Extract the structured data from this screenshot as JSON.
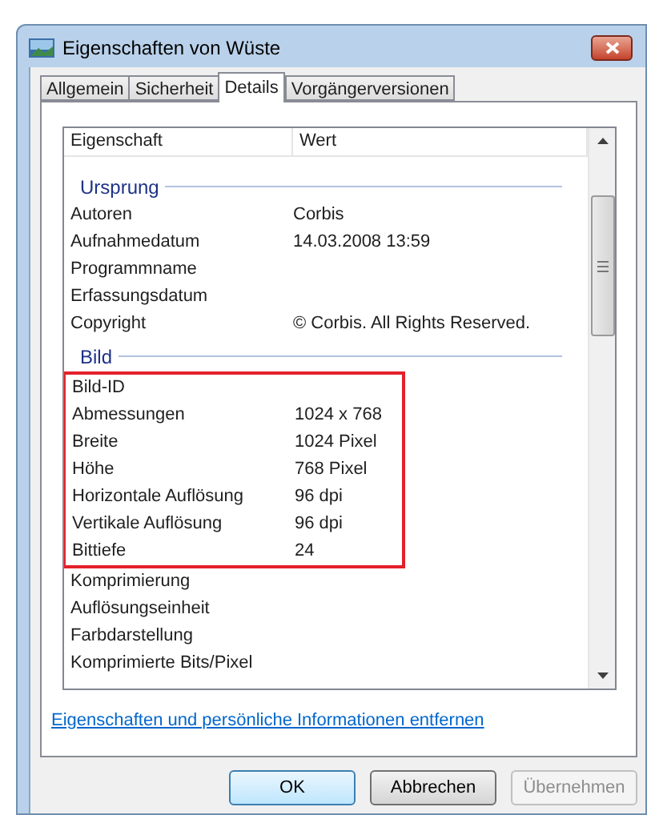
{
  "window": {
    "title": "Eigenschaften von Wüste"
  },
  "tabs": [
    {
      "label": "Allgemein",
      "selected": false
    },
    {
      "label": "Sicherheit",
      "selected": false
    },
    {
      "label": "Details",
      "selected": true
    },
    {
      "label": "Vorgängerversionen",
      "selected": false
    }
  ],
  "table": {
    "columns": [
      "Eigenschaft",
      "Wert"
    ],
    "sections": [
      {
        "title": "Ursprung",
        "groups": [
          {
            "highlighted": false,
            "rows": [
              {
                "name": "Autoren",
                "value": "Corbis"
              },
              {
                "name": "Aufnahmedatum",
                "value": "14.03.2008 13:59"
              },
              {
                "name": "Programmname"
              },
              {
                "name": "Erfassungsdatum"
              },
              {
                "name": "Copyright",
                "value": "© Corbis.  All Rights Reserved."
              }
            ]
          }
        ]
      },
      {
        "title": "Bild",
        "groups": [
          {
            "highlighted": true,
            "rows": [
              {
                "name": "Bild-ID"
              },
              {
                "name": "Abmessungen",
                "value": "1024 x 768"
              },
              {
                "name": "Breite",
                "value": "1024 Pixel"
              },
              {
                "name": "Höhe",
                "value": "768 Pixel"
              },
              {
                "name": "Horizontale Auflösung",
                "value": "96 dpi"
              },
              {
                "name": "Vertikale Auflösung",
                "value": "96 dpi"
              },
              {
                "name": "Bittiefe",
                "value": "24"
              }
            ]
          },
          {
            "highlighted": false,
            "rows": [
              {
                "name": "Komprimierung"
              },
              {
                "name": "Auflösungseinheit"
              },
              {
                "name": "Farbdarstellung"
              },
              {
                "name": "Komprimierte Bits/Pixel"
              }
            ]
          }
        ]
      }
    ]
  },
  "link": "Eigenschaften und persönliche Informationen entfernen",
  "buttons": [
    {
      "label": "OK",
      "default": true,
      "disabled": false
    },
    {
      "label": "Abbrechen",
      "default": false,
      "disabled": false
    },
    {
      "label": "Übernehmen",
      "default": false,
      "disabled": true
    }
  ]
}
